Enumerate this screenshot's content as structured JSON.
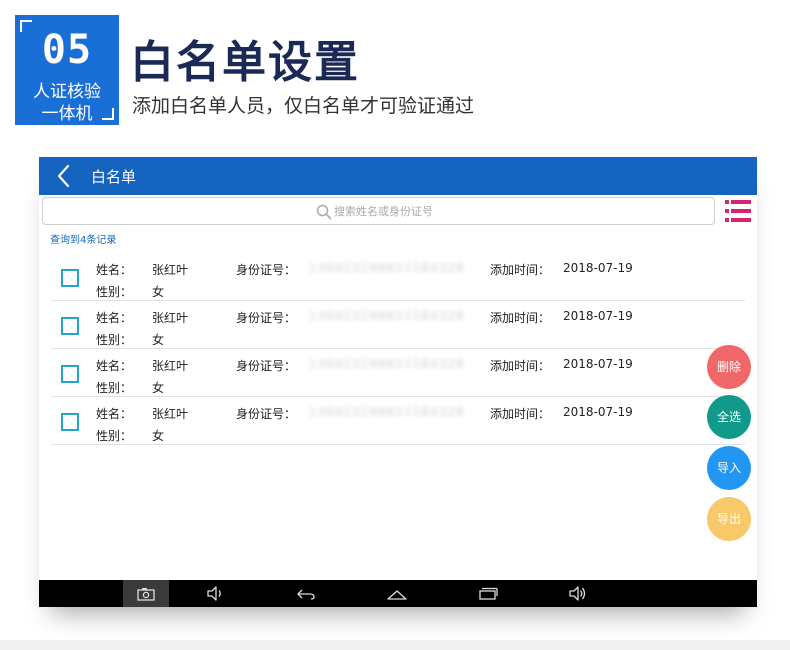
{
  "banner": {
    "number": "05",
    "product_line1": "人证核验",
    "product_line2": "一体机",
    "title": "白名单设置",
    "subtitle": "添加白名单人员，仅白名单才可验证通过"
  },
  "app": {
    "title": "白名单",
    "search_placeholder": "搜索姓名或身份证号",
    "result_count": "查询到4条记录",
    "labels": {
      "name": "姓名：",
      "gender": "性别：",
      "id": "身份证号：",
      "added": "添加时间："
    },
    "records": [
      {
        "name": "张红叶",
        "gender": "女",
        "id": "130423198811184328",
        "added": "2018-07-19"
      },
      {
        "name": "张红叶",
        "gender": "女",
        "id": "130423198811184328",
        "added": "2018-07-19"
      },
      {
        "name": "张红叶",
        "gender": "女",
        "id": "130423198811184328",
        "added": "2018-07-19"
      },
      {
        "name": "张红叶",
        "gender": "女",
        "id": "130423198811184328",
        "added": "2018-07-19"
      }
    ],
    "actions": {
      "delete": "删除",
      "select_all": "全选",
      "import": "导入",
      "export": "导出"
    }
  },
  "colors": {
    "banner_blue": "#1a6fd6",
    "title_navy": "#1b2a55",
    "topbar": "#1565c0",
    "delete": "#f06767",
    "select_all": "#11998a",
    "import": "#2196f3",
    "export": "#f7c968",
    "menu_icon": "#d6246e"
  },
  "icons": {
    "back": "chevron-left-icon",
    "search": "search-icon",
    "menu": "list-menu-icon",
    "nav": [
      "camera-icon",
      "volume-down-icon",
      "back-arrow-icon",
      "home-icon",
      "recent-apps-icon",
      "volume-up-icon"
    ]
  }
}
